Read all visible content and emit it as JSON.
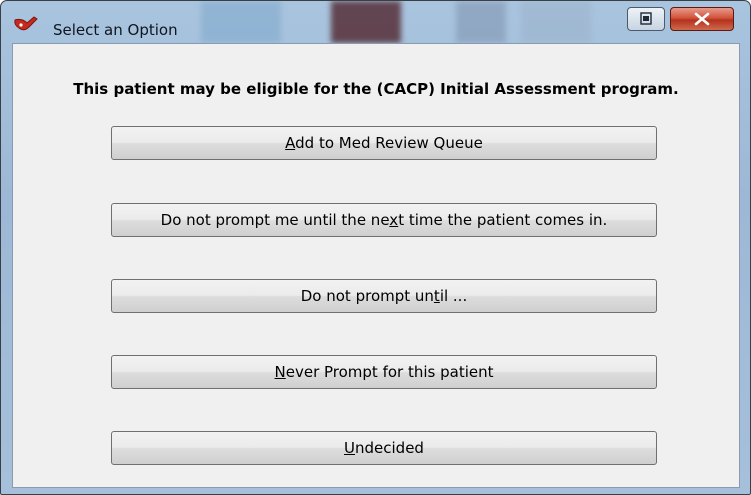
{
  "window": {
    "title": "Select an Option"
  },
  "prompt": "This patient may be eligible for the (CACP) Initial Assessment program.",
  "buttons": [
    {
      "pre": "",
      "key": "A",
      "post": "dd to Med Review Queue"
    },
    {
      "pre": "Do not prompt me until the ne",
      "key": "x",
      "post": "t time the patient comes in."
    },
    {
      "pre": "Do not prompt un",
      "key": "t",
      "post": "il ..."
    },
    {
      "pre": "",
      "key": "N",
      "post": "ever Prompt for this patient"
    },
    {
      "pre": "",
      "key": "U",
      "post": "ndecided"
    }
  ],
  "colors": {
    "titlebar": "#9cb8d6",
    "client": "#f0f0f0",
    "close": "#c7432b"
  }
}
